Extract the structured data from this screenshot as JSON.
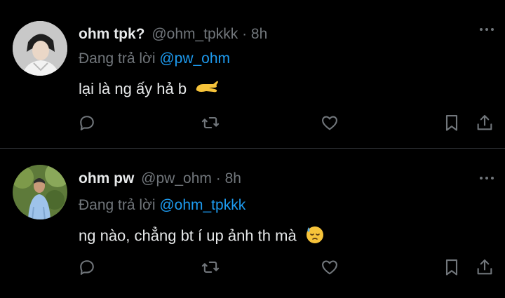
{
  "tweets": [
    {
      "name": "ohm tpk?",
      "handle": "@ohm_tpkkk",
      "separator": "·",
      "time": "8h",
      "reply_prefix": "Đang trả lời",
      "reply_to": "@pw_ohm",
      "text": "lại là ng ấy hả b",
      "emoji": "pinching-hand-emoji"
    },
    {
      "name": "ohm pw",
      "handle": "@pw_ohm",
      "separator": "·",
      "time": "8h",
      "reply_prefix": "Đang trả lời",
      "reply_to": "@ohm_tpkkk",
      "text": "ng nào, chẳng bt í up ảnh th mà",
      "emoji": "downcast-face-with-sweat-emoji"
    }
  ],
  "icons": [
    "reply-icon",
    "retweet-icon",
    "like-icon",
    "bookmark-icon",
    "share-icon",
    "more-icon"
  ],
  "colors": {
    "background": "#000000",
    "text": "#e7e9ea",
    "muted": "#71767b",
    "link": "#1d9bf0",
    "divider": "#2f3336"
  }
}
